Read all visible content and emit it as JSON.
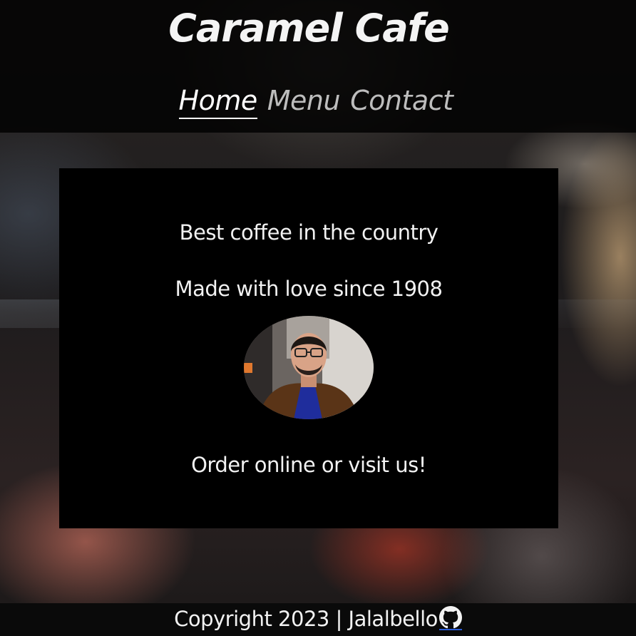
{
  "header": {
    "title": "Caramel Cafe",
    "nav": [
      {
        "label": "Home",
        "active": true
      },
      {
        "label": "Menu",
        "active": false
      },
      {
        "label": "Contact",
        "active": false
      }
    ]
  },
  "main": {
    "tagline1": "Best coffee in the country",
    "tagline2": "Made with love since 1908",
    "photo_alt": "profile photo of a man with glasses",
    "cta": "Order online or visit us!"
  },
  "footer": {
    "text": "Copyright 2023 | Jalalbello",
    "icon": "github-icon"
  },
  "colors": {
    "header_bg": "#000000",
    "box_bg": "#000000",
    "text": "#f2f2f2",
    "nav_inactive": "#bdbdbd",
    "link_underline": "#2a5bd7"
  }
}
